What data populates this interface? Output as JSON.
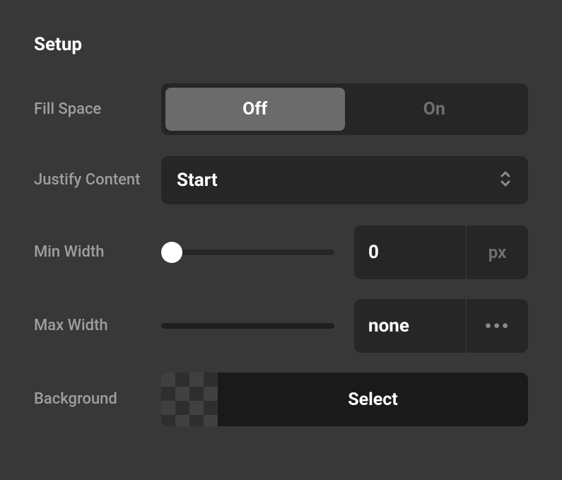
{
  "section_title": "Setup",
  "fill_space": {
    "label": "Fill Space",
    "option_off": "Off",
    "option_on": "On",
    "value": "Off"
  },
  "justify_content": {
    "label": "Justify Content",
    "value": "Start"
  },
  "min_width": {
    "label": "Min Width",
    "value": "0",
    "unit": "px",
    "slider_position": 0
  },
  "max_width": {
    "label": "Max Width",
    "value": "none"
  },
  "background": {
    "label": "Background",
    "action": "Select"
  }
}
